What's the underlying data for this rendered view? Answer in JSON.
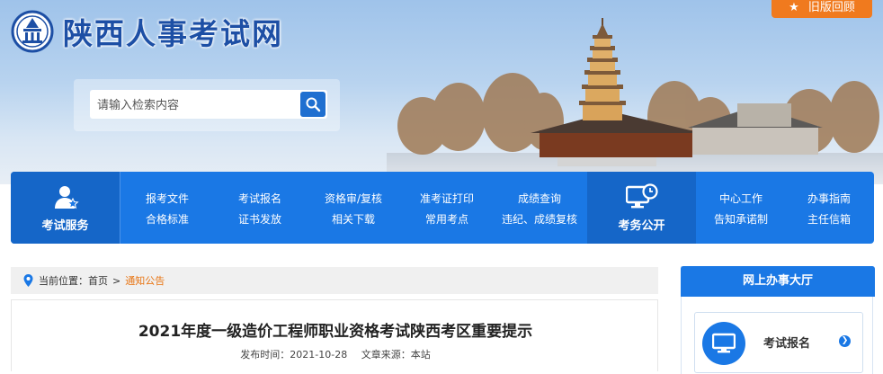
{
  "header": {
    "site_title": "陕西人事考试网",
    "old_version_label": "旧版回顾",
    "search_placeholder": "请输入检索内容"
  },
  "nav": {
    "exam_service": {
      "label": "考试服务",
      "links": [
        [
          "报考文件",
          "合格标准"
        ],
        [
          "考试报名",
          "证书发放"
        ],
        [
          "资格审/复核",
          "相关下载"
        ],
        [
          "准考证打印",
          "常用考点"
        ],
        [
          "成绩查询",
          "违纪、成绩复核"
        ]
      ]
    },
    "exam_affairs": {
      "label": "考务公开",
      "links": [
        [
          "中心工作",
          "告知承诺制"
        ],
        [
          "办事指南",
          "主任信箱"
        ]
      ]
    }
  },
  "breadcrumb": {
    "prefix": "当前位置：",
    "home": "首页",
    "separator": ">",
    "current": "通知公告"
  },
  "article": {
    "title": "2021年度一级造价工程师职业资格考试陕西考区重要提示",
    "publish_label": "发布时间：2021-10-28",
    "source_label": "文章来源：本站"
  },
  "online_hall": {
    "title": "网上办事大厅",
    "service_label": "考试报名"
  },
  "colors": {
    "primary_blue": "#1a78e5",
    "accent_orange": "#f07a1e",
    "breadcrumb_current": "#e87412"
  }
}
